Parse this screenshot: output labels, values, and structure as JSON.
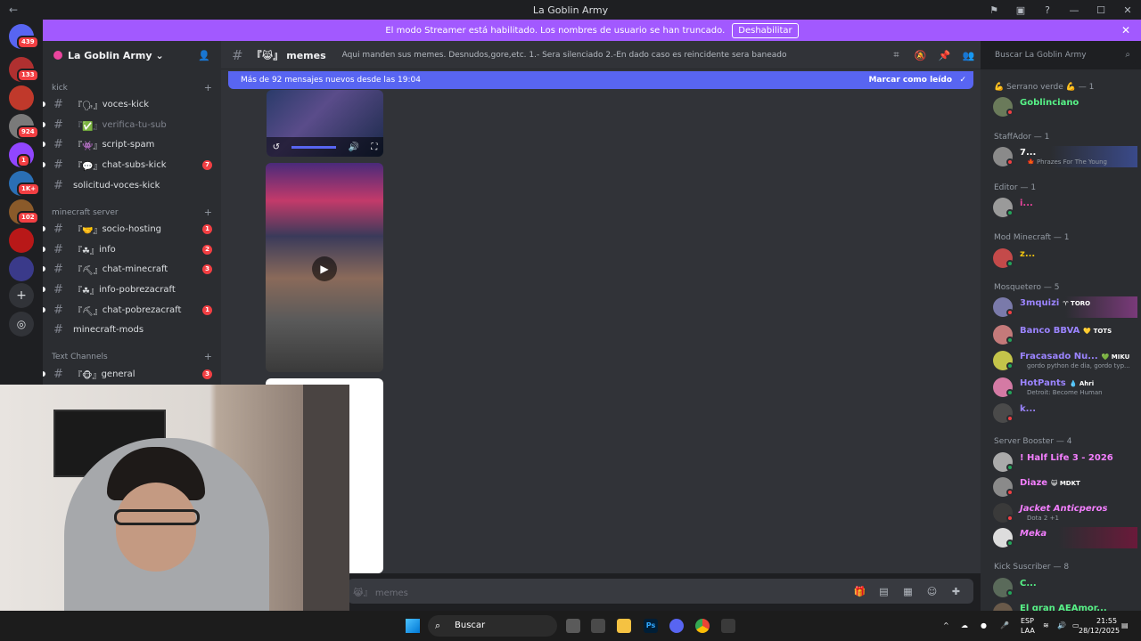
{
  "window": {
    "title": "La Goblin Army"
  },
  "banner": {
    "text": "El modo Streamer está habilitado. Los nombres de usuario se han truncado.",
    "button": "Deshabilitar"
  },
  "server_badges": [
    "439",
    "133",
    "924",
    "1",
    "1K+",
    "102"
  ],
  "guild": {
    "name": "La Goblin Army"
  },
  "categories": {
    "kick": "kick",
    "minecraft": "minecraft server",
    "text": "Text Channels"
  },
  "channels": [
    {
      "prefix": "『🗣』",
      "name": "voces-kick",
      "badge": ""
    },
    {
      "prefix": "『✅』",
      "name": "verifica-tu-sub",
      "badge": ""
    },
    {
      "prefix": "『👾』",
      "name": "script-spam",
      "badge": ""
    },
    {
      "prefix": "『💬』",
      "name": "chat-subs-kick",
      "badge": "7"
    },
    {
      "prefix": "",
      "name": "solicitud-voces-kick",
      "badge": ""
    },
    {
      "prefix": "『🤝』",
      "name": "socio-hosting",
      "badge": "1"
    },
    {
      "prefix": "『☘』",
      "name": "info",
      "badge": "2"
    },
    {
      "prefix": "『⛏』",
      "name": "chat-minecraft",
      "badge": "3"
    },
    {
      "prefix": "『☘』",
      "name": "info-pobrezacraft",
      "badge": ""
    },
    {
      "prefix": "『⛏』",
      "name": "chat-pobrezacraft",
      "badge": "1"
    },
    {
      "prefix": "",
      "name": "minecraft-mods",
      "badge": ""
    },
    {
      "prefix": "『🐵』",
      "name": "general",
      "badge": "3"
    }
  ],
  "channel_header": {
    "name": "『😹』 memes",
    "topic": "Aqui manden sus memes. Desnudos,gore,etc. 1.- Sera silenciado 2.-En dado caso es reincidente sera baneado"
  },
  "search": {
    "placeholder": "Buscar La Goblin Army"
  },
  "new_messages": {
    "text": "Más de 92 mensajes nuevos desde las 19:04",
    "mark": "Marcar como leído"
  },
  "composer": {
    "placeholder": "😹』 memes"
  },
  "roles": [
    "💪 Serrano verde 💪 — 1",
    "StaffAdor — 1",
    "Editor — 1",
    "Mod Minecraft — 1",
    "Mosquetero — 5",
    "Server Booster — 4",
    "Kick Suscriber — 8"
  ],
  "members": [
    {
      "name": "Goblinciano",
      "color": "#57f287",
      "status": "#f23f43",
      "tag": "",
      "sub": ""
    },
    {
      "name": "7...",
      "color": "#ffffff",
      "status": "#f23f43",
      "tag": "",
      "sub": "🍁 Phrazes For The Young"
    },
    {
      "name": "i...",
      "color": "#eb459e",
      "status": "#23a55a",
      "tag": "",
      "sub": ""
    },
    {
      "name": "z...",
      "color": "#f1c40f",
      "status": "#23a55a",
      "tag": "",
      "sub": ""
    },
    {
      "name": "3mquizi",
      "color": "#9b84ff",
      "status": "#f23f43",
      "tag": "♈ TORO",
      "sub": ""
    },
    {
      "name": "Banco BBVA",
      "color": "#9b84ff",
      "status": "#23a55a",
      "tag": "💛 TOTS",
      "sub": ""
    },
    {
      "name": "Fracasado Nu...",
      "color": "#9b84ff",
      "status": "#23a55a",
      "tag": "💚 MIKU",
      "sub": "gordo python de dia, gordo typ..."
    },
    {
      "name": "HotPants",
      "color": "#9b84ff",
      "status": "#23a55a",
      "tag": "💧 Ahri",
      "sub": "Detroit: Become Human"
    },
    {
      "name": "k...",
      "color": "#9b84ff",
      "status": "#f23f43",
      "tag": "",
      "sub": ""
    },
    {
      "name": "! Half Life 3 - 2026",
      "color": "#f47fff",
      "status": "#23a55a",
      "tag": "",
      "sub": ""
    },
    {
      "name": "Diaze",
      "color": "#f47fff",
      "status": "#f23f43",
      "tag": "😺 MDKT",
      "sub": ""
    },
    {
      "name": "Jacket Anticperos",
      "color": "#f47fff",
      "status": "#f23f43",
      "tag": "",
      "sub": "Dota 2 +1"
    },
    {
      "name": "Meka",
      "color": "#f47fff",
      "status": "#23a55a",
      "tag": "",
      "sub": ""
    },
    {
      "name": "C...",
      "color": "#57f287",
      "status": "#23a55a",
      "tag": "",
      "sub": ""
    },
    {
      "name": "El gran AEAmor...",
      "color": "#57f287",
      "status": "#23a55a",
      "tag": "",
      "sub": ""
    }
  ],
  "taskbar": {
    "search": "Buscar",
    "lang": "ESP",
    "lang2": "LAA",
    "time": "21:55",
    "date": "28/12/2025"
  }
}
